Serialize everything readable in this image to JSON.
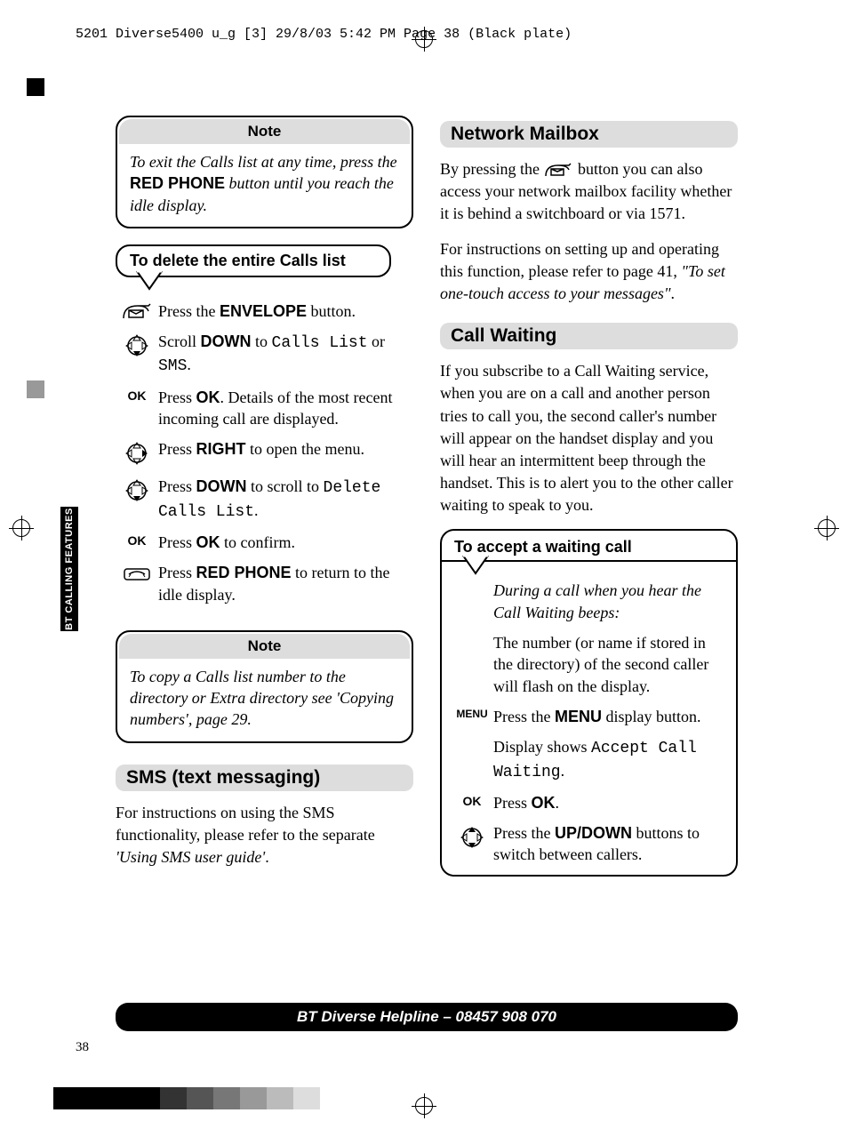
{
  "print_header": "5201 Diverse5400  u_g [3]  29/8/03  5:42 PM  Page 38   (Black plate)",
  "side_tab": "BT CALLING FEATURES",
  "page_number": "38",
  "footer": "BT Diverse Helpline – 08457 908 070",
  "note1": {
    "title": "Note",
    "pre": "To exit the Calls list at any time, press the ",
    "bold": "RED PHONE",
    "post": " button until you reach the idle display."
  },
  "proc_delete": {
    "title": "To delete the entire Calls list",
    "steps": {
      "s1": {
        "pre": "Press the ",
        "b": "ENVELOPE",
        "post": " button."
      },
      "s2": {
        "pre": "Scroll ",
        "b": "DOWN",
        "mid": " to ",
        "lcd1": "Calls List",
        "or": " or ",
        "lcd2": "SMS",
        "post": "."
      },
      "s3": {
        "label": "OK",
        "pre": "Press ",
        "b": "OK",
        "post": ". Details of the most recent incoming call are displayed."
      },
      "s4": {
        "pre": "Press ",
        "b": "RIGHT",
        "post": " to open the menu."
      },
      "s5": {
        "pre": "Press ",
        "b": "DOWN",
        "mid": " to scroll to ",
        "lcd": "Delete Calls List",
        "post": "."
      },
      "s6": {
        "label": "OK",
        "pre": "Press ",
        "b": "OK",
        "post": " to confirm."
      },
      "s7": {
        "pre": "Press ",
        "b": "RED PHONE",
        "post": " to return to the idle display."
      }
    }
  },
  "note2": {
    "title": "Note",
    "text": "To copy a Calls list number to the directory or Extra directory see 'Copying numbers', page 29."
  },
  "sms": {
    "heading": "SMS (text messaging)",
    "p_pre": "For instructions on using the SMS functionality, please refer to the separate ",
    "p_ital": "'Using SMS user guide'",
    "p_post": "."
  },
  "mailbox": {
    "heading": "Network Mailbox",
    "p1_pre": "By pressing the ",
    "p1_post": " button you can also access your network mailbox facility whether it is behind a switchboard or via 1571.",
    "p2_pre": "For instructions on setting up and operating this function, please refer to page 41, ",
    "p2_ital": "\"To set one-touch access to your messages\"",
    "p2_post": "."
  },
  "callwaiting": {
    "heading": "Call Waiting",
    "p": "If you subscribe to a Call Waiting service, when you are on a call and another person tries to call you, the second caller's number will appear on the handset display and you will hear an intermittent beep through the handset. This is to alert you to the other caller waiting to speak to you."
  },
  "proc_accept": {
    "title": "To accept a waiting call",
    "intro": "During a call when you hear the Call Waiting beeps:",
    "s1": "The number (or name if stored in the directory) of the second caller will flash on the display.",
    "s2": {
      "label": "MENU",
      "pre": "Press the ",
      "b": "MENU",
      "post": " display button."
    },
    "s3": {
      "pre": "Display shows ",
      "lcd": "Accept Call Waiting",
      "post": "."
    },
    "s4": {
      "label": "OK",
      "pre": "Press ",
      "b": "OK",
      "post": "."
    },
    "s5": {
      "pre": "Press the ",
      "b": "UP/DOWN",
      "post": " buttons to switch between callers."
    }
  },
  "colors": [
    "#000",
    "#000",
    "#000",
    "#000",
    "#333",
    "#555",
    "#777",
    "#999",
    "#bbb",
    "#ddd"
  ]
}
